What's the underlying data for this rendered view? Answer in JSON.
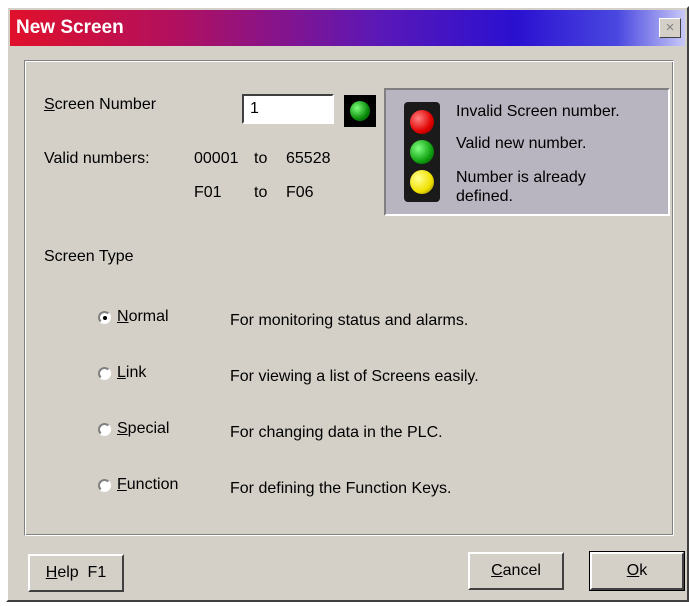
{
  "window": {
    "title": "New Screen",
    "close_glyph": "×"
  },
  "screen_number": {
    "label_accel": "S",
    "label_rest": "creen Number",
    "value": "1",
    "status_color": "#0a8a0a"
  },
  "valid_numbers": {
    "label": "Valid numbers:",
    "range1_from": "00001",
    "range1_to_word": "to",
    "range1_to": "65528",
    "range2_from": "F01",
    "range2_to_word": "to",
    "range2_to": "F06"
  },
  "legend": {
    "red": "Invalid Screen number.",
    "green": "Valid new number.",
    "yellow": "Number is already defined."
  },
  "screen_type": {
    "label": "Screen Type",
    "options": [
      {
        "accel": "N",
        "rest": "ormal",
        "description": "For monitoring status and alarms.",
        "selected": true
      },
      {
        "accel": "L",
        "rest": "ink",
        "description": "For viewing a list of Screens easily.",
        "selected": false
      },
      {
        "accel": "S",
        "rest": "pecial",
        "description": "For changing data in the PLC.",
        "selected": false
      },
      {
        "accel": "F",
        "rest": "unction",
        "description": "For defining the Function Keys.",
        "selected": false
      }
    ]
  },
  "buttons": {
    "help_accel": "H",
    "help_rest": "elp  F1",
    "cancel_accel": "C",
    "cancel_rest": "ancel",
    "ok_accel": "O",
    "ok_rest": "k"
  }
}
